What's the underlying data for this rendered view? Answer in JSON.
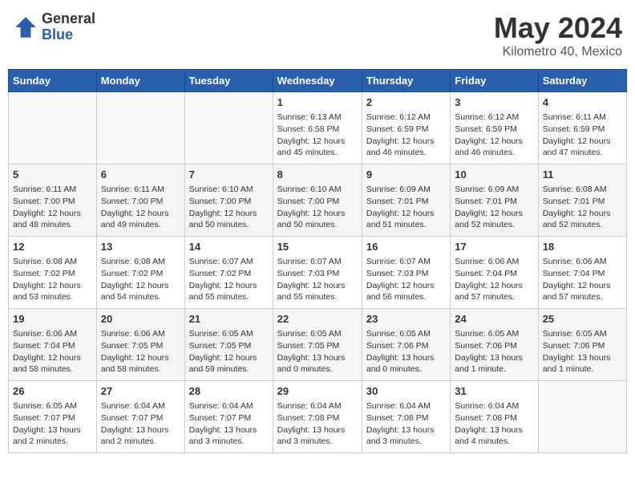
{
  "header": {
    "logo_general": "General",
    "logo_blue": "Blue",
    "title": "May 2024",
    "location": "Kilometro 40, Mexico"
  },
  "weekdays": [
    "Sunday",
    "Monday",
    "Tuesday",
    "Wednesday",
    "Thursday",
    "Friday",
    "Saturday"
  ],
  "days": {
    "1": {
      "sunrise": "6:13 AM",
      "sunset": "6:58 PM",
      "daylight": "12 hours and 45 minutes."
    },
    "2": {
      "sunrise": "6:12 AM",
      "sunset": "6:59 PM",
      "daylight": "12 hours and 46 minutes."
    },
    "3": {
      "sunrise": "6:12 AM",
      "sunset": "6:59 PM",
      "daylight": "12 hours and 46 minutes."
    },
    "4": {
      "sunrise": "6:11 AM",
      "sunset": "6:59 PM",
      "daylight": "12 hours and 47 minutes."
    },
    "5": {
      "sunrise": "6:11 AM",
      "sunset": "7:00 PM",
      "daylight": "12 hours and 48 minutes."
    },
    "6": {
      "sunrise": "6:11 AM",
      "sunset": "7:00 PM",
      "daylight": "12 hours and 49 minutes."
    },
    "7": {
      "sunrise": "6:10 AM",
      "sunset": "7:00 PM",
      "daylight": "12 hours and 50 minutes."
    },
    "8": {
      "sunrise": "6:10 AM",
      "sunset": "7:00 PM",
      "daylight": "12 hours and 50 minutes."
    },
    "9": {
      "sunrise": "6:09 AM",
      "sunset": "7:01 PM",
      "daylight": "12 hours and 51 minutes."
    },
    "10": {
      "sunrise": "6:09 AM",
      "sunset": "7:01 PM",
      "daylight": "12 hours and 52 minutes."
    },
    "11": {
      "sunrise": "6:08 AM",
      "sunset": "7:01 PM",
      "daylight": "12 hours and 52 minutes."
    },
    "12": {
      "sunrise": "6:08 AM",
      "sunset": "7:02 PM",
      "daylight": "12 hours and 53 minutes."
    },
    "13": {
      "sunrise": "6:08 AM",
      "sunset": "7:02 PM",
      "daylight": "12 hours and 54 minutes."
    },
    "14": {
      "sunrise": "6:07 AM",
      "sunset": "7:02 PM",
      "daylight": "12 hours and 55 minutes."
    },
    "15": {
      "sunrise": "6:07 AM",
      "sunset": "7:03 PM",
      "daylight": "12 hours and 55 minutes."
    },
    "16": {
      "sunrise": "6:07 AM",
      "sunset": "7:03 PM",
      "daylight": "12 hours and 56 minutes."
    },
    "17": {
      "sunrise": "6:06 AM",
      "sunset": "7:04 PM",
      "daylight": "12 hours and 57 minutes."
    },
    "18": {
      "sunrise": "6:06 AM",
      "sunset": "7:04 PM",
      "daylight": "12 hours and 57 minutes."
    },
    "19": {
      "sunrise": "6:06 AM",
      "sunset": "7:04 PM",
      "daylight": "12 hours and 58 minutes."
    },
    "20": {
      "sunrise": "6:06 AM",
      "sunset": "7:05 PM",
      "daylight": "12 hours and 58 minutes."
    },
    "21": {
      "sunrise": "6:05 AM",
      "sunset": "7:05 PM",
      "daylight": "12 hours and 59 minutes."
    },
    "22": {
      "sunrise": "6:05 AM",
      "sunset": "7:05 PM",
      "daylight": "13 hours and 0 minutes."
    },
    "23": {
      "sunrise": "6:05 AM",
      "sunset": "7:06 PM",
      "daylight": "13 hours and 0 minutes."
    },
    "24": {
      "sunrise": "6:05 AM",
      "sunset": "7:06 PM",
      "daylight": "13 hours and 1 minute."
    },
    "25": {
      "sunrise": "6:05 AM",
      "sunset": "7:06 PM",
      "daylight": "13 hours and 1 minute."
    },
    "26": {
      "sunrise": "6:05 AM",
      "sunset": "7:07 PM",
      "daylight": "13 hours and 2 minutes."
    },
    "27": {
      "sunrise": "6:04 AM",
      "sunset": "7:07 PM",
      "daylight": "13 hours and 2 minutes."
    },
    "28": {
      "sunrise": "6:04 AM",
      "sunset": "7:07 PM",
      "daylight": "13 hours and 3 minutes."
    },
    "29": {
      "sunrise": "6:04 AM",
      "sunset": "7:08 PM",
      "daylight": "13 hours and 3 minutes."
    },
    "30": {
      "sunrise": "6:04 AM",
      "sunset": "7:08 PM",
      "daylight": "13 hours and 3 minutes."
    },
    "31": {
      "sunrise": "6:04 AM",
      "sunset": "7:08 PM",
      "daylight": "13 hours and 4 minutes."
    }
  },
  "labels": {
    "sunrise": "Sunrise:",
    "sunset": "Sunset:",
    "daylight": "Daylight:"
  }
}
